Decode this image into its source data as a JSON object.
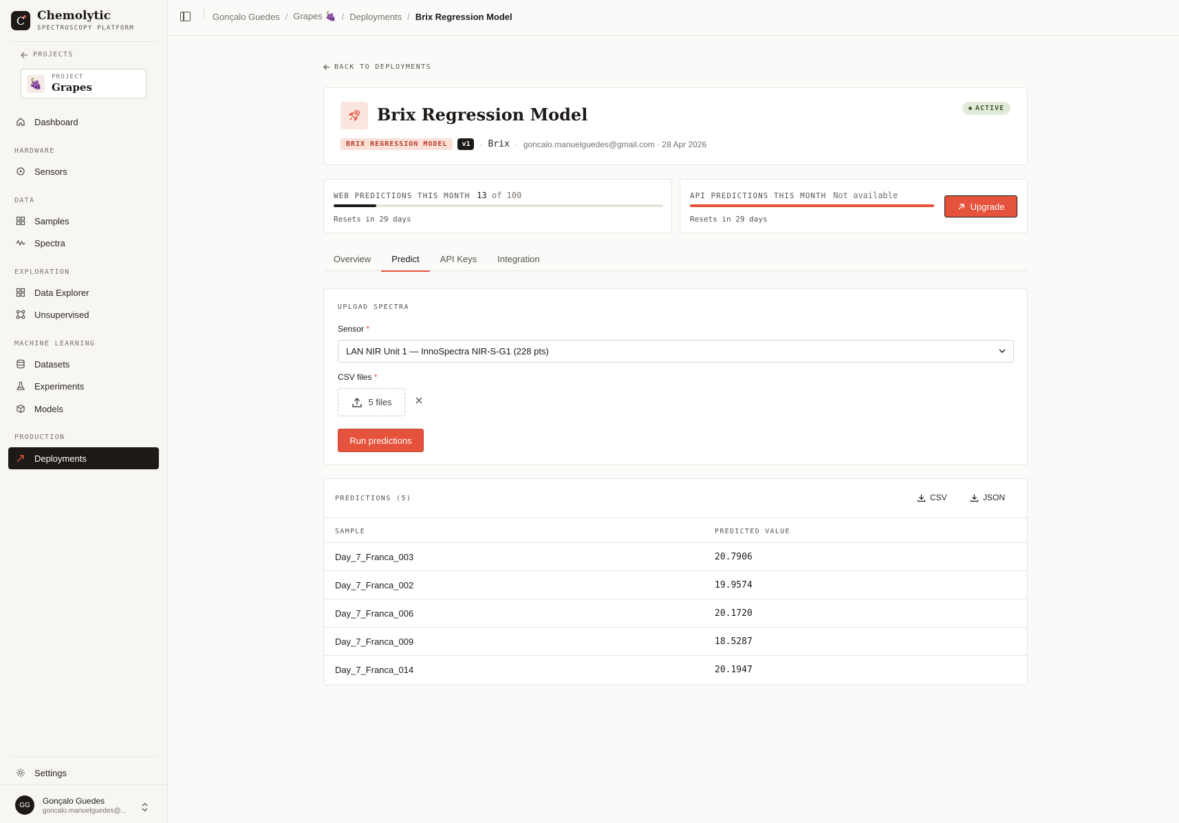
{
  "app": {
    "name": "Chemolytic",
    "subtitle": "SPECTROSCOPY PLATFORM",
    "logo_letter": "C"
  },
  "sidebar": {
    "back_label": "PROJECTS",
    "project_label": "PROJECT",
    "project_name": "Grapes",
    "project_icon": "grapes-emoji",
    "dashboard": "Dashboard",
    "sections": {
      "hardware": "HARDWARE",
      "data": "DATA",
      "exploration": "EXPLORATION",
      "ml": "MACHINE LEARNING",
      "production": "PRODUCTION"
    },
    "items": {
      "sensors": "Sensors",
      "samples": "Samples",
      "spectra": "Spectra",
      "data_explorer": "Data Explorer",
      "unsupervised": "Unsupervised",
      "datasets": "Datasets",
      "experiments": "Experiments",
      "models": "Models",
      "deployments": "Deployments",
      "settings": "Settings"
    },
    "user": {
      "initials": "GG",
      "name": "Gonçalo Guedes",
      "email": "goncalo.manuelguedes@..."
    }
  },
  "breadcrumb": {
    "user": "Gonçalo Guedes",
    "project": "Grapes 🍇",
    "section": "Deployments",
    "current": "Brix Regression Model"
  },
  "page": {
    "back_link": "BACK TO DEPLOYMENTS",
    "title": "Brix Regression Model",
    "status": "ACTIVE",
    "model_tag": "BRIX REGRESSION MODEL",
    "version": "v1",
    "target": "Brix",
    "creator_date": "goncalo.manuelguedes@gmail.com · 28 Apr 2026"
  },
  "usage": {
    "web": {
      "title": "WEB PREDICTIONS THIS MONTH",
      "used": "13",
      "limit_text": "of 100",
      "fraction": 0.13,
      "reset": "Resets in 29 days"
    },
    "api": {
      "title": "API PREDICTIONS THIS MONTH",
      "status": "Not available",
      "fraction": 1.0,
      "reset": "Resets in 29 days",
      "upgrade_label": "Upgrade"
    }
  },
  "tabs": [
    "Overview",
    "Predict",
    "API Keys",
    "Integration"
  ],
  "active_tab": "Predict",
  "upload": {
    "section_title": "UPLOAD SPECTRA",
    "sensor_label": "Sensor",
    "sensor_value": "LAN NIR Unit 1 — InnoSpectra NIR-S-G1 (228 pts)",
    "csv_label": "CSV files",
    "files_value": "5 files",
    "run_label": "Run predictions",
    "required_mark": "*"
  },
  "predictions": {
    "title": "PREDICTIONS (5)",
    "csv_label": "CSV",
    "json_label": "JSON",
    "col_sample": "SAMPLE",
    "col_value": "PREDICTED VALUE",
    "rows": [
      {
        "sample": "Day_7_Franca_003",
        "value": "20.7906"
      },
      {
        "sample": "Day_7_Franca_002",
        "value": "19.9574"
      },
      {
        "sample": "Day_7_Franca_006",
        "value": "20.1720"
      },
      {
        "sample": "Day_7_Franca_009",
        "value": "18.5287"
      },
      {
        "sample": "Day_7_Franca_014",
        "value": "20.1947"
      }
    ]
  },
  "colors": {
    "accent": "#e5533c",
    "dark": "#1c1917",
    "active_badge_bg": "#e2ebd9"
  }
}
